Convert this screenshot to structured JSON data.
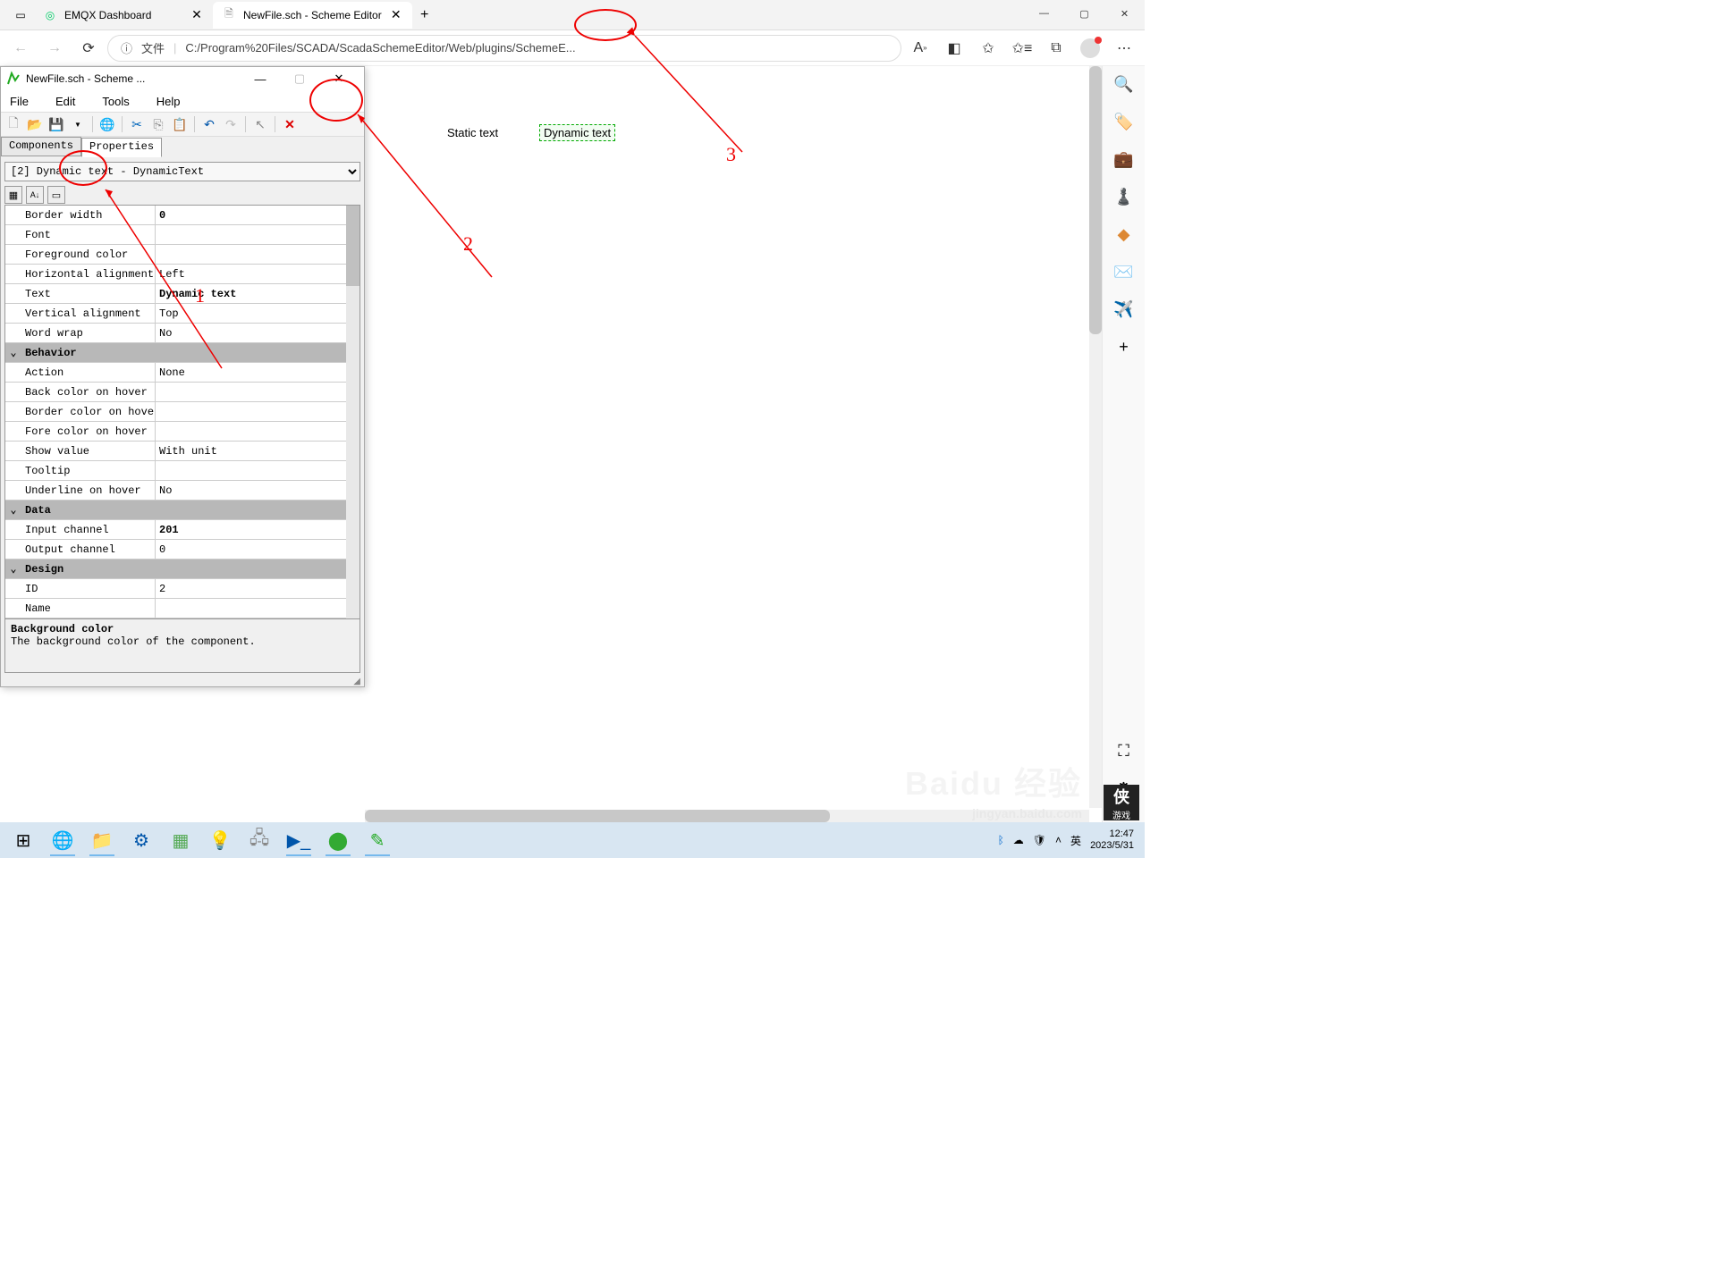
{
  "browser": {
    "tabs": [
      {
        "title": "EMQX Dashboard",
        "active": false
      },
      {
        "title": "NewFile.sch - Scheme Editor",
        "active": true
      }
    ],
    "address_label": "文件",
    "address": "C:/Program%20Files/SCADA/ScadaSchemeEditor/Web/plugins/SchemeE...",
    "window_controls": {
      "minimize": "—",
      "maximize": "▢",
      "close": "✕"
    }
  },
  "right_sidebar_icons": [
    "search-icon",
    "tag-icon",
    "briefcase-icon",
    "chess-icon",
    "office-icon",
    "outlook-icon",
    "telegram-icon",
    "plus-icon",
    "capture-icon",
    "settings-icon"
  ],
  "editor": {
    "title": "NewFile.sch - Scheme ...",
    "menu": [
      "File",
      "Edit",
      "Tools",
      "Help"
    ],
    "tabs": {
      "components": "Components",
      "properties": "Properties"
    },
    "selector": "[2] Dynamic text - DynamicText",
    "properties": [
      {
        "type": "row",
        "name": "Border width",
        "value": "0",
        "bold": true
      },
      {
        "type": "row",
        "name": "Font",
        "value": ""
      },
      {
        "type": "row",
        "name": "Foreground color",
        "value": ""
      },
      {
        "type": "row",
        "name": "Horizontal alignment",
        "value": "Left"
      },
      {
        "type": "row",
        "name": "Text",
        "value": "Dynamic text",
        "bold": true
      },
      {
        "type": "row",
        "name": "Vertical alignment",
        "value": "Top"
      },
      {
        "type": "row",
        "name": "Word wrap",
        "value": "No"
      },
      {
        "type": "group",
        "name": "Behavior"
      },
      {
        "type": "row",
        "name": "Action",
        "value": "None"
      },
      {
        "type": "row",
        "name": "Back color on hover",
        "value": ""
      },
      {
        "type": "row",
        "name": "Border color on hover",
        "value": ""
      },
      {
        "type": "row",
        "name": "Fore color on hover",
        "value": ""
      },
      {
        "type": "row",
        "name": "Show value",
        "value": "With unit"
      },
      {
        "type": "row",
        "name": "Tooltip",
        "value": ""
      },
      {
        "type": "row",
        "name": "Underline on hover",
        "value": "No"
      },
      {
        "type": "group",
        "name": "Data"
      },
      {
        "type": "row",
        "name": "Input channel",
        "value": "201",
        "bold": true
      },
      {
        "type": "row",
        "name": "Output channel",
        "value": "0"
      },
      {
        "type": "group",
        "name": "Design"
      },
      {
        "type": "row",
        "name": "ID",
        "value": "2"
      },
      {
        "type": "row",
        "name": "Name",
        "value": ""
      }
    ],
    "desc_title": "Background color",
    "desc_text": "The background color of the component."
  },
  "canvas": {
    "static_text": "Static text",
    "dynamic_text": "Dynamic text"
  },
  "annotations": {
    "n1": "1",
    "n2": "2",
    "n3": "3"
  },
  "taskbar": {
    "tray_ime": "英",
    "time": "12:47",
    "date": "2023/5/31"
  },
  "watermark": {
    "baidu": "Baidu 经验",
    "url": "jingyan.baidu.com",
    "corner_top": "侠",
    "corner_bottom": "游戏"
  }
}
